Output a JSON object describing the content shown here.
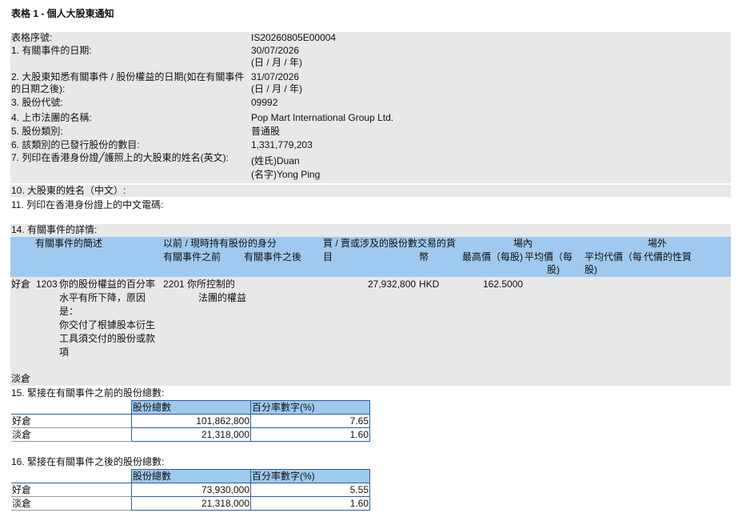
{
  "title": "表格 1 - 個人大股東通知",
  "fields": [
    {
      "label": "表格序號:",
      "value": "IS20260805E00004"
    },
    {
      "label": "1. 有關事件的日期:",
      "value": "30/07/2026",
      "note": "(日 / 月 / 年)"
    },
    {
      "label_line1": "2. 大股東知悉有關事件 / 股份權益的日期(如在有關事件",
      "label_line2": "的日期之後):",
      "value": "31/07/2026",
      "note": "(日 / 月 / 年)"
    },
    {
      "label": "3. 股份代號:",
      "value": "09992"
    },
    {
      "label": "4. 上市法團的名稱:",
      "value": "Pop Mart International Group Ltd."
    },
    {
      "label": "5. 股份類別:",
      "value": "普通股"
    },
    {
      "label": "6. 該類別的已發行股份的數目:",
      "value": "1,331,779,203"
    },
    {
      "label": "7. 列印在香港身份證╱護照上的大股東的姓名(英文):",
      "value": "(姓氏)Duan",
      "value2": "(名字)Yong Ping"
    }
  ],
  "section10": "10. 大股東的姓名（中文）:",
  "section11": "11. 列印在香港身份證上的中文電碼:",
  "section14": {
    "title": "14. 有關事件的詳情:",
    "headers": {
      "event_desc": "有關事件的簡述",
      "capacity": "以前 / 現時持有股份的身分",
      "capacity_before": "有關事件之前",
      "capacity_after": "有關事件之後",
      "shares_line1": "買 / 賣或涉及的股份數交易的貨",
      "shares_line2": "目",
      "currency": "幣",
      "on_exchange": "場內",
      "highest_price": "最高價（每股)",
      "avg_price_line1": "平均價（每",
      "avg_price_line2": "股)",
      "off_exchange": "場外",
      "avg_price_off_line1": "平均代價（每",
      "avg_price_off_line2": "股)",
      "consideration_type": "代價的性質"
    },
    "row": {
      "position": "好倉",
      "code_before": "1203",
      "desc_lines": [
        "你的股份權益的百分率",
        "水平有所下降，原因",
        "是：",
        "你交付了根據股本衍生",
        "工具須交付的股份或款",
        "項"
      ],
      "code_after": "2201",
      "after_lines": [
        "你所控制的",
        "法團的權益"
      ],
      "shares": "27,932,800",
      "currency": "HKD",
      "highest_price": "162.5000"
    },
    "short_label": "淡倉"
  },
  "section15": {
    "title": "15. 緊接在有關事件之前的股份總數:",
    "col_shares": "股份總數",
    "col_pct": "百分率數字(%)",
    "rows": [
      {
        "label": "好倉",
        "shares": "101,862,800",
        "pct": "7.65"
      },
      {
        "label": "淡倉",
        "shares": "21,318,000",
        "pct": "1.60"
      }
    ]
  },
  "section16": {
    "title": "16. 緊接在有關事件之後的股份總數:",
    "col_shares": "股份總數",
    "col_pct": "百分率數字(%)",
    "rows": [
      {
        "label": "好倉",
        "shares": "73,930,000",
        "pct": "5.55"
      },
      {
        "label": "淡倉",
        "shares": "21,318,000",
        "pct": "1.60"
      }
    ]
  }
}
